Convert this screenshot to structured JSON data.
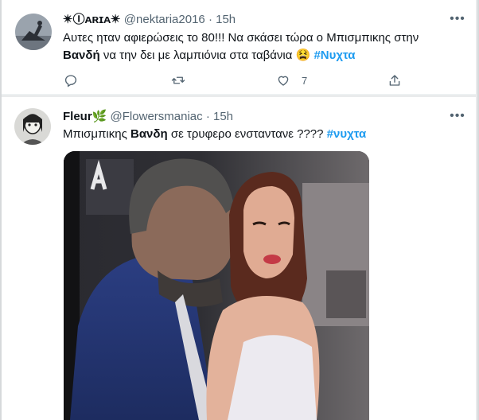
{
  "tweets": [
    {
      "display_name": "✴Ⓘᴀʀɪᴀ✴",
      "handle": "@nektaria2016",
      "separator": "·",
      "time": "15h",
      "text_line1": "Αυτες ηταν αφιερώσεις το 80!!! Να σκάσει τώρα ο Μπισμπικης στην",
      "text_bold": "Βανδή",
      "text_line2": " να την δει με λαμπιόνια στα ταβάνια ",
      "emoji": "😫",
      "hashtag": "#Νυχτα",
      "like_count": "7"
    },
    {
      "display_name": "Fleur",
      "name_emoji": "🌿",
      "handle": "@Flowersmaniac",
      "separator": "·",
      "time": "15h",
      "text_before": "Μπισμπικης ",
      "text_bold": "Βανδη",
      "text_after": " σε τρυφερο ενσταντανε ???? ",
      "hashtag": "#νυχτα"
    }
  ],
  "icons": [
    "more-icon",
    "reply-icon",
    "retweet-icon",
    "like-icon",
    "share-icon"
  ],
  "colors": {
    "hashtag": "#1d9bf0",
    "secondary": "#536471",
    "text": "#0f1419"
  }
}
